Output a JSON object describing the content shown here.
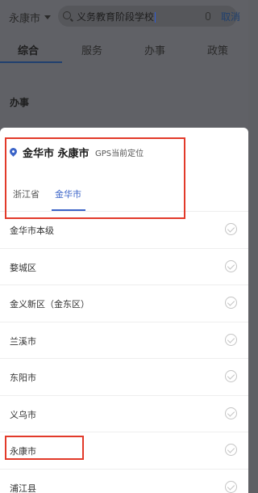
{
  "header": {
    "city": "永康市",
    "search_value": "义务教育阶段学校",
    "cancel_label": "取消"
  },
  "tabs": [
    "综合",
    "服务",
    "办事",
    "政策"
  ],
  "section_title": "办事",
  "location_sheet": {
    "gps_city": "金华市 永康市",
    "gps_note": "GPS当前定位",
    "levels": [
      {
        "label": "浙江省",
        "active": false
      },
      {
        "label": "金华市",
        "active": true
      }
    ],
    "districts": [
      "金华市本级",
      "婺城区",
      "金义新区（金东区）",
      "兰溪市",
      "东阳市",
      "义乌市",
      "永康市",
      "浦江县"
    ]
  },
  "colors": {
    "accent": "#3b64c8",
    "highlight_box": "#e23a2a",
    "overlay": "#606166"
  },
  "icons": [
    "search-icon",
    "mic-icon",
    "location-pin-icon",
    "check-circle-icon"
  ]
}
